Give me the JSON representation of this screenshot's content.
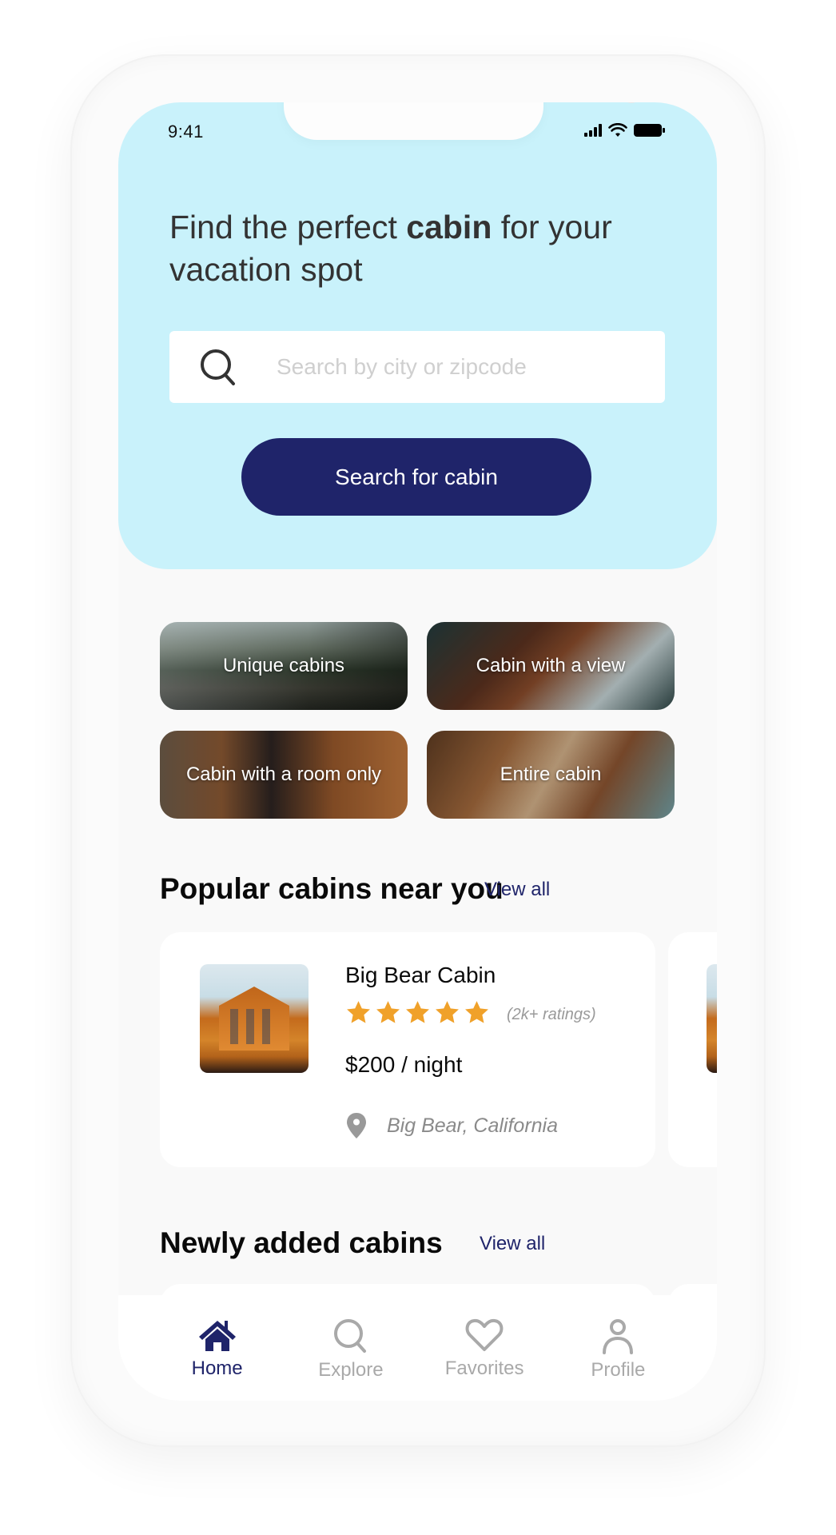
{
  "status_bar": {
    "time": "9:41"
  },
  "hero": {
    "headline_pre": "Find the perfect ",
    "headline_bold": "cabin",
    "headline_post": " for your vacation spot",
    "search_placeholder": "Search by city or zipcode",
    "search_value": "",
    "search_icon": "search-icon",
    "cta_label": "Search for cabin"
  },
  "categories": [
    {
      "label": "Unique cabins"
    },
    {
      "label": "Cabin with a view"
    },
    {
      "label": "Cabin with a room only"
    },
    {
      "label": "Entire cabin"
    }
  ],
  "popular": {
    "title": "Popular cabins near you",
    "view_all": "View all",
    "cards": [
      {
        "name": "Big Bear Cabin",
        "rating": 5,
        "rating_max": 5,
        "ratings_count": "(2k+ ratings)",
        "price": "$200",
        "price_unit": " / night",
        "location": "Big Bear, California"
      }
    ]
  },
  "newly_added": {
    "title": "Newly added cabins",
    "view_all": "View all"
  },
  "nav": {
    "items": [
      {
        "label": "Home",
        "icon": "home-icon",
        "active": true
      },
      {
        "label": "Explore",
        "icon": "search-icon",
        "active": false
      },
      {
        "label": "Favorites",
        "icon": "heart-icon",
        "active": false
      },
      {
        "label": "Profile",
        "icon": "user-icon",
        "active": false
      }
    ]
  },
  "colors": {
    "hero_bg": "#c9f2fb",
    "primary": "#1f246a",
    "star": "#f0a12a",
    "inactive": "#a9a9a9"
  }
}
